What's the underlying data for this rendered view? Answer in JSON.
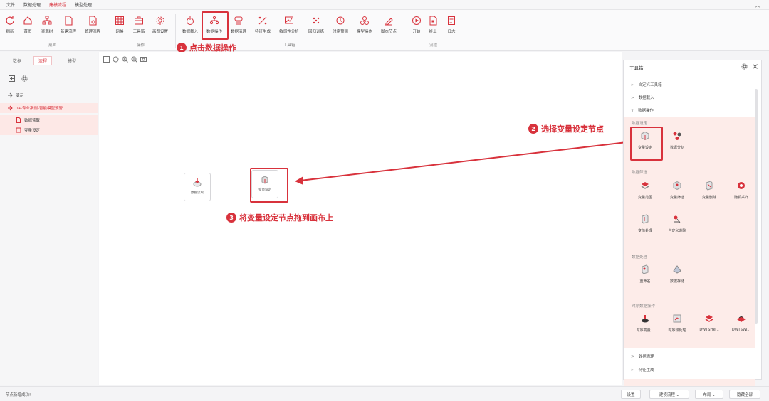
{
  "menubar": {
    "items": [
      {
        "label": "文件",
        "active": false
      },
      {
        "label": "数据处理",
        "active": false
      },
      {
        "label": "建模流程",
        "active": true
      },
      {
        "label": "模型处理",
        "active": false
      }
    ],
    "collapse_icon": "chevron-up-icon"
  },
  "ribbon": {
    "tools": [
      {
        "label": "刷新",
        "icon": "refresh-icon"
      },
      {
        "label": "首页",
        "icon": "home-icon"
      },
      {
        "label": "资源树",
        "icon": "tree-icon"
      },
      {
        "label": "新建流程",
        "icon": "new-file-icon"
      },
      {
        "label": "管理流程",
        "icon": "manage-file-icon"
      },
      {
        "label": "网格",
        "icon": "grid-icon"
      },
      {
        "label": "工具箱",
        "icon": "toolbox-icon"
      },
      {
        "label": "画图设置",
        "icon": "gear-icon"
      },
      {
        "label": "数据载入",
        "icon": "data-load-icon"
      },
      {
        "label": "数据操作",
        "icon": "data-operation-icon"
      },
      {
        "label": "数据清理",
        "icon": "data-clean-icon"
      },
      {
        "label": "特征生成",
        "icon": "feature-icon"
      },
      {
        "label": "敏感性分析",
        "icon": "sensitivity-icon"
      },
      {
        "label": "回归训练",
        "icon": "regression-icon"
      },
      {
        "label": "时序预测",
        "icon": "timeseries-icon"
      },
      {
        "label": "模型操作",
        "icon": "model-icon"
      },
      {
        "label": "脚本节点",
        "icon": "script-icon"
      },
      {
        "label": "开始",
        "icon": "play-icon"
      },
      {
        "label": "终止",
        "icon": "stop-icon"
      },
      {
        "label": "日志",
        "icon": "log-icon"
      }
    ],
    "groups": [
      "桌面",
      "操作",
      "工具箱",
      "流程"
    ]
  },
  "callouts": [
    {
      "num": "1",
      "text": "点击数据操作"
    },
    {
      "num": "2",
      "text": "选择变量设定节点"
    },
    {
      "num": "3",
      "text": "将变量设定节点拖到画布上"
    }
  ],
  "left_panel": {
    "tabs": [
      {
        "label": "数据",
        "active": false
      },
      {
        "label": "流程",
        "active": true
      },
      {
        "label": "模型",
        "active": false
      }
    ],
    "tree": [
      {
        "label": "演示",
        "selected": false
      },
      {
        "label": "04-专业案例-智能模型预警",
        "selected": true,
        "accent": true
      },
      {
        "label": "数据读取",
        "selected": true
      },
      {
        "label": "变量设定",
        "selected": true
      }
    ]
  },
  "canvas": {
    "nodes": [
      {
        "label": "数据读取",
        "icon": "data-read-icon"
      },
      {
        "label": "变量设定",
        "icon": "variable-set-icon"
      }
    ]
  },
  "toolbox": {
    "title": "工具箱",
    "sections_top": [
      {
        "label": "自定义工具箱",
        "expanded": false
      },
      {
        "label": "数据载入",
        "expanded": false
      },
      {
        "label": "数据操作",
        "expanded": true
      }
    ],
    "categories": [
      {
        "title": "数据设定",
        "items": [
          {
            "label": "变量设定"
          },
          {
            "label": "数据分割"
          }
        ]
      },
      {
        "title": "数据筛选",
        "items": [
          {
            "label": "变量范围"
          },
          {
            "label": "变量筛选"
          },
          {
            "label": "变量删除"
          },
          {
            "label": "随机采样"
          },
          {
            "label": "变值处理"
          },
          {
            "label": "自定义割除"
          }
        ]
      },
      {
        "title": "数据处理",
        "items": [
          {
            "label": "重命名"
          },
          {
            "label": "数据存储"
          }
        ]
      },
      {
        "title": "时序数据操作",
        "items": [
          {
            "label": "时序变量..."
          },
          {
            "label": "时序预处理"
          },
          {
            "label": "DWTSFre..."
          },
          {
            "label": "DWTSWI..."
          }
        ]
      }
    ],
    "sections_bottom": [
      {
        "label": "数据清理",
        "expanded": false
      },
      {
        "label": "特征生成",
        "expanded": false
      }
    ]
  },
  "statusbar": {
    "message": "节点新增成功!",
    "buttons": [
      {
        "label": "设置"
      },
      {
        "label": "建模流程 ⌄"
      },
      {
        "label": "布局 ⌄"
      },
      {
        "label": "隐藏全部"
      }
    ]
  },
  "colors": {
    "accent": "#d8323c",
    "highlight_bg": "#fdece9"
  }
}
